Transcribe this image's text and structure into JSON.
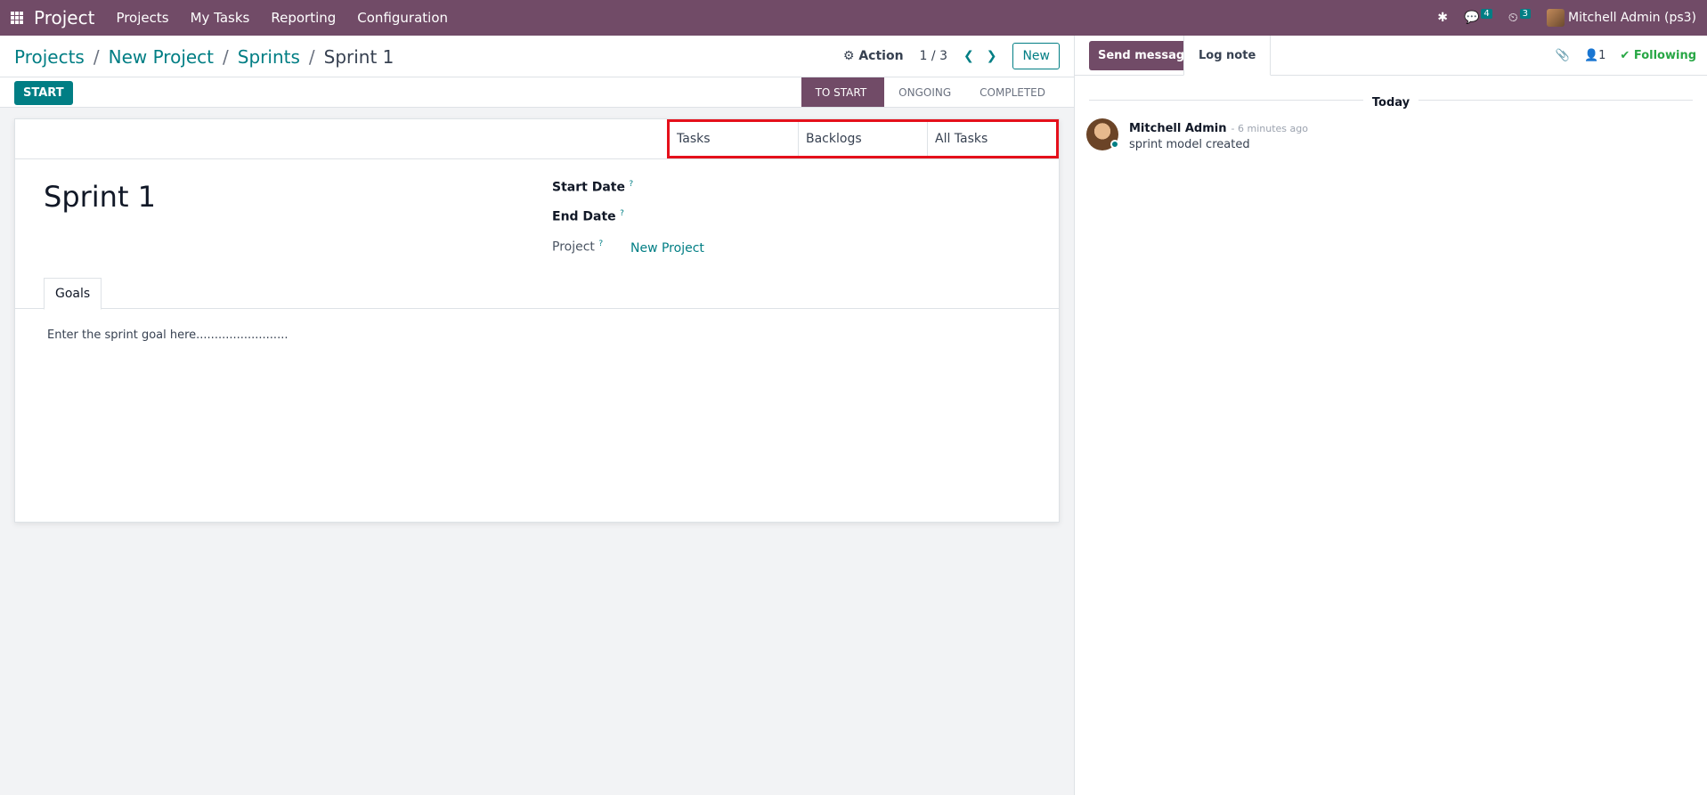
{
  "topbar": {
    "app_name": "Project",
    "menu": [
      "Projects",
      "My Tasks",
      "Reporting",
      "Configuration"
    ],
    "messages_count": "4",
    "activities_count": "3",
    "user": "Mitchell Admin (ps3)",
    "bug_icon": "bug-icon",
    "chat_icon": "chat-icon",
    "clock_icon": "clock-icon"
  },
  "breadcrumb": {
    "items": [
      "Projects",
      "New Project",
      "Sprints"
    ],
    "current": "Sprint 1"
  },
  "control": {
    "action_label": "Action",
    "pager": "1 / 3",
    "new_label": "New"
  },
  "statusbar": {
    "start_label": "START",
    "stages": [
      "TO START",
      "ONGOING",
      "COMPLETED"
    ],
    "active_stage": "TO START"
  },
  "smart_buttons": [
    "Tasks",
    "Backlogs",
    "All Tasks"
  ],
  "record": {
    "title": "Sprint 1",
    "start_date_label": "Start Date",
    "end_date_label": "End Date",
    "project_label": "Project",
    "project_value": "New Project",
    "help_mark": "?"
  },
  "tabs": {
    "goals": "Goals",
    "goal_text": "Enter the sprint goal here........................."
  },
  "chatter": {
    "send_message": "Send message",
    "log_note": "Log note",
    "followers_count": "1",
    "following": "Following",
    "today": "Today",
    "message": {
      "author": "Mitchell Admin",
      "ago": "- 6 minutes ago",
      "body": "sprint model created"
    }
  },
  "colors": {
    "brand": "#714b67",
    "accent": "#017e84",
    "highlight": "#e5101b",
    "following": "#28a745"
  }
}
